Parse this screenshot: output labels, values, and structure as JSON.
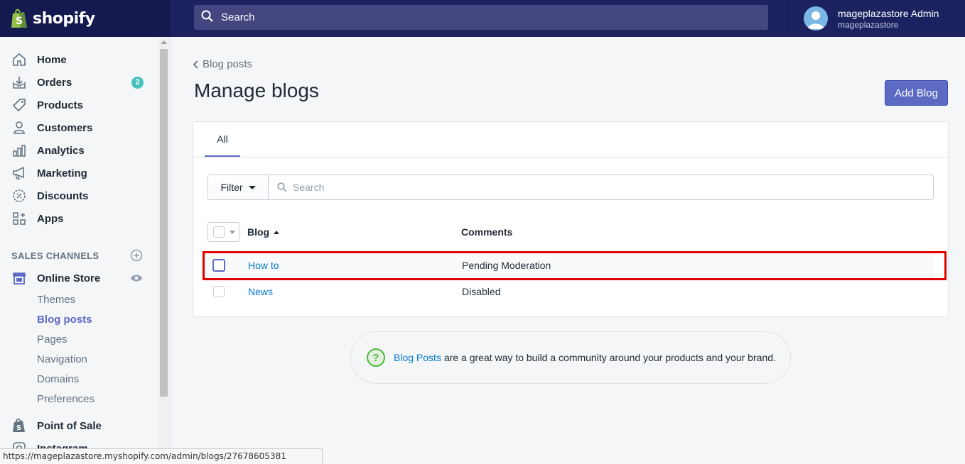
{
  "topbar": {
    "logo_text": "shopify",
    "search_placeholder": "Search",
    "user_name": "mageplazastore Admin",
    "user_store": "mageplazastore"
  },
  "sidebar": {
    "items": [
      {
        "label": "Home",
        "icon": "home-icon"
      },
      {
        "label": "Orders",
        "icon": "orders-icon",
        "badge": "2"
      },
      {
        "label": "Products",
        "icon": "tag-icon"
      },
      {
        "label": "Customers",
        "icon": "person-icon"
      },
      {
        "label": "Analytics",
        "icon": "bar-chart-icon"
      },
      {
        "label": "Marketing",
        "icon": "megaphone-icon"
      },
      {
        "label": "Discounts",
        "icon": "discount-icon"
      },
      {
        "label": "Apps",
        "icon": "apps-icon"
      }
    ],
    "sales_channels_title": "SALES CHANNELS",
    "online_store": "Online Store",
    "sub_items": [
      "Themes",
      "Blog posts",
      "Pages",
      "Navigation",
      "Domains",
      "Preferences"
    ],
    "active_sub": "Blog posts",
    "point_of_sale": "Point of Sale",
    "instagram": "Instagram"
  },
  "main": {
    "breadcrumb": "Blog posts",
    "title": "Manage blogs",
    "add_button": "Add Blog",
    "tab_all": "All",
    "filter_label": "Filter",
    "search_placeholder": "Search",
    "col_blog": "Blog",
    "col_comments": "Comments",
    "rows": [
      {
        "blog": "How to",
        "comments": "Pending Moderation"
      },
      {
        "blog": "News",
        "comments": "Disabled"
      }
    ],
    "help_link": "Blog Posts",
    "help_text": "are a great way to build a community around your products and your brand."
  },
  "status_url": "https://mageplazastore.myshopify.com/admin/blogs/27678605381",
  "colors": {
    "accent": "#5c6ac4",
    "topbar": "#1c2260",
    "link": "#007ace",
    "highlight_box": "#e00000"
  }
}
